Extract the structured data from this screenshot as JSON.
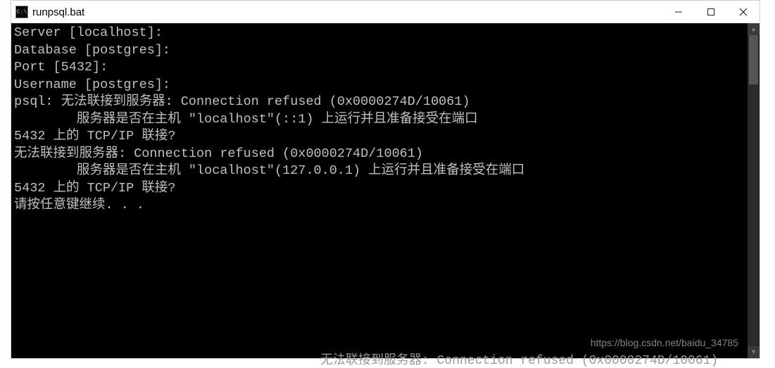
{
  "window": {
    "icon_label": "C:\\",
    "title": "runpsql.bat"
  },
  "terminal": {
    "lines": [
      "Server [localhost]:",
      "Database [postgres]:",
      "Port [5432]:",
      "Username [postgres]:",
      "psql: 无法联接到服务器: Connection refused (0x0000274D/10061)",
      "        服务器是否在主机 \"localhost\"(::1) 上运行并且准备接受在端口",
      "5432 上的 TCP/IP 联接?",
      "无法联接到服务器: Connection refused (0x0000274D/10061)",
      "        服务器是否在主机 \"localhost\"(127.0.0.1) 上运行并且准备接受在端口",
      "5432 上的 TCP/IP 联接?",
      "请按任意键继续. . ."
    ]
  },
  "watermark": "https://blog.csdn.net/baidu_34785",
  "peek": "无法联接到服务器: Connection refused (0x0000274D/10061)"
}
